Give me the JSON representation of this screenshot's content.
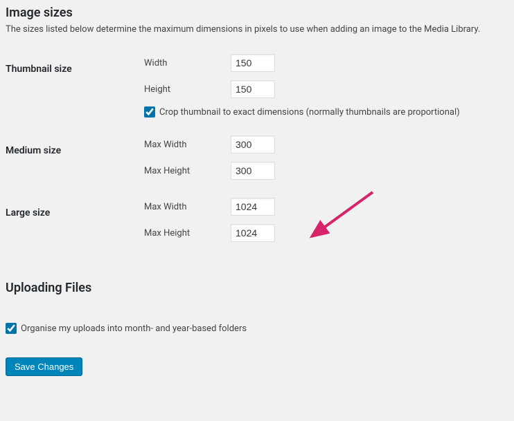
{
  "heading_image_sizes": "Image sizes",
  "image_sizes_desc": "The sizes listed below determine the maximum dimensions in pixels to use when adding an image to the Media Library.",
  "thumbnail": {
    "group_label": "Thumbnail size",
    "width_label": "Width",
    "width_value": "150",
    "height_label": "Height",
    "height_value": "150",
    "crop_label": "Crop thumbnail to exact dimensions (normally thumbnails are proportional)",
    "crop_checked": true
  },
  "medium": {
    "group_label": "Medium size",
    "max_width_label": "Max Width",
    "max_width_value": "300",
    "max_height_label": "Max Height",
    "max_height_value": "300"
  },
  "large": {
    "group_label": "Large size",
    "max_width_label": "Max Width",
    "max_width_value": "1024",
    "max_height_label": "Max Height",
    "max_height_value": "1024"
  },
  "heading_uploading": "Uploading Files",
  "organise": {
    "label": "Organise my uploads into month- and year-based folders",
    "checked": true
  },
  "save_button": "Save Changes",
  "arrow_color": "#d63384"
}
